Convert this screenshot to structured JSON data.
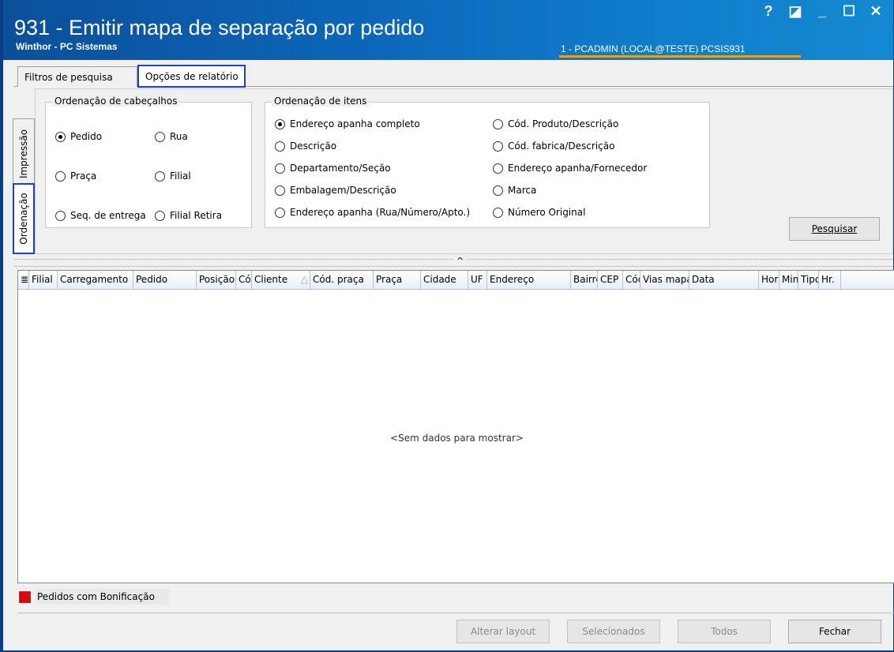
{
  "window": {
    "title": "931 - Emitir mapa de separação por pedido",
    "subtitle": "Winthor - PC Sistemas",
    "user_info": "1 - PCADMIN (LOCAL@TESTE)   PCSIS931",
    "controls": {
      "help": "?",
      "restore": "◪",
      "minimize": "_",
      "maximize": "☐",
      "close": "✕"
    }
  },
  "tabs": [
    {
      "label": "Filtros de pesquisa"
    },
    {
      "label": "Opções de relatório"
    }
  ],
  "side_tabs": [
    {
      "label": "Impressão"
    },
    {
      "label": "Ordenação"
    }
  ],
  "ordenacao_cabecalhos": {
    "title": "Ordenação de cabeçalhos",
    "options": [
      {
        "label": "Pedido",
        "selected": true
      },
      {
        "label": "Rua",
        "selected": false
      },
      {
        "label": "Praça",
        "selected": false
      },
      {
        "label": "Filial",
        "selected": false
      },
      {
        "label": "Seq. de entrega",
        "selected": false
      },
      {
        "label": "Filial Retira",
        "selected": false
      }
    ]
  },
  "ordenacao_itens": {
    "title": "Ordenação de itens",
    "options": [
      {
        "label": "Endereço apanha completo",
        "selected": true
      },
      {
        "label": "Descrição",
        "selected": false
      },
      {
        "label": "Departamento/Seção",
        "selected": false
      },
      {
        "label": "Embalagem/Descrição",
        "selected": false
      },
      {
        "label": "Endereço apanha (Rua/Número/Apto.)",
        "selected": false
      },
      {
        "label": "Cód. Produto/Descrição",
        "selected": false
      },
      {
        "label": "Cód. fabrica/Descrição",
        "selected": false
      },
      {
        "label": "Endereço apanha/Fornecedor",
        "selected": false
      },
      {
        "label": "Marca",
        "selected": false
      },
      {
        "label": "Número Original",
        "selected": false
      }
    ]
  },
  "search_button": "Pesquisar",
  "splitter_icon": "^",
  "grid": {
    "columns": [
      "≣",
      "Filial",
      "Carregamento",
      "Pedido",
      "Posição",
      "Cód",
      "Cliente",
      "Cód. praça",
      "Praça",
      "Cidade",
      "UF",
      "Endereço",
      "Bairro",
      "CEP",
      "Cód",
      "Vias mapa",
      "Data",
      "Hora",
      "Min",
      "Tipo",
      "Hr."
    ],
    "sort_indicator": "△",
    "empty_message": "<Sem dados para mostrar>"
  },
  "legend": {
    "label": "Pedidos com Bonificação",
    "color": "#e80000"
  },
  "footer": {
    "alterar_layout": "Alterar layout",
    "selecionados": "Selecionados",
    "todos": "Todos",
    "fechar": "Fechar"
  }
}
